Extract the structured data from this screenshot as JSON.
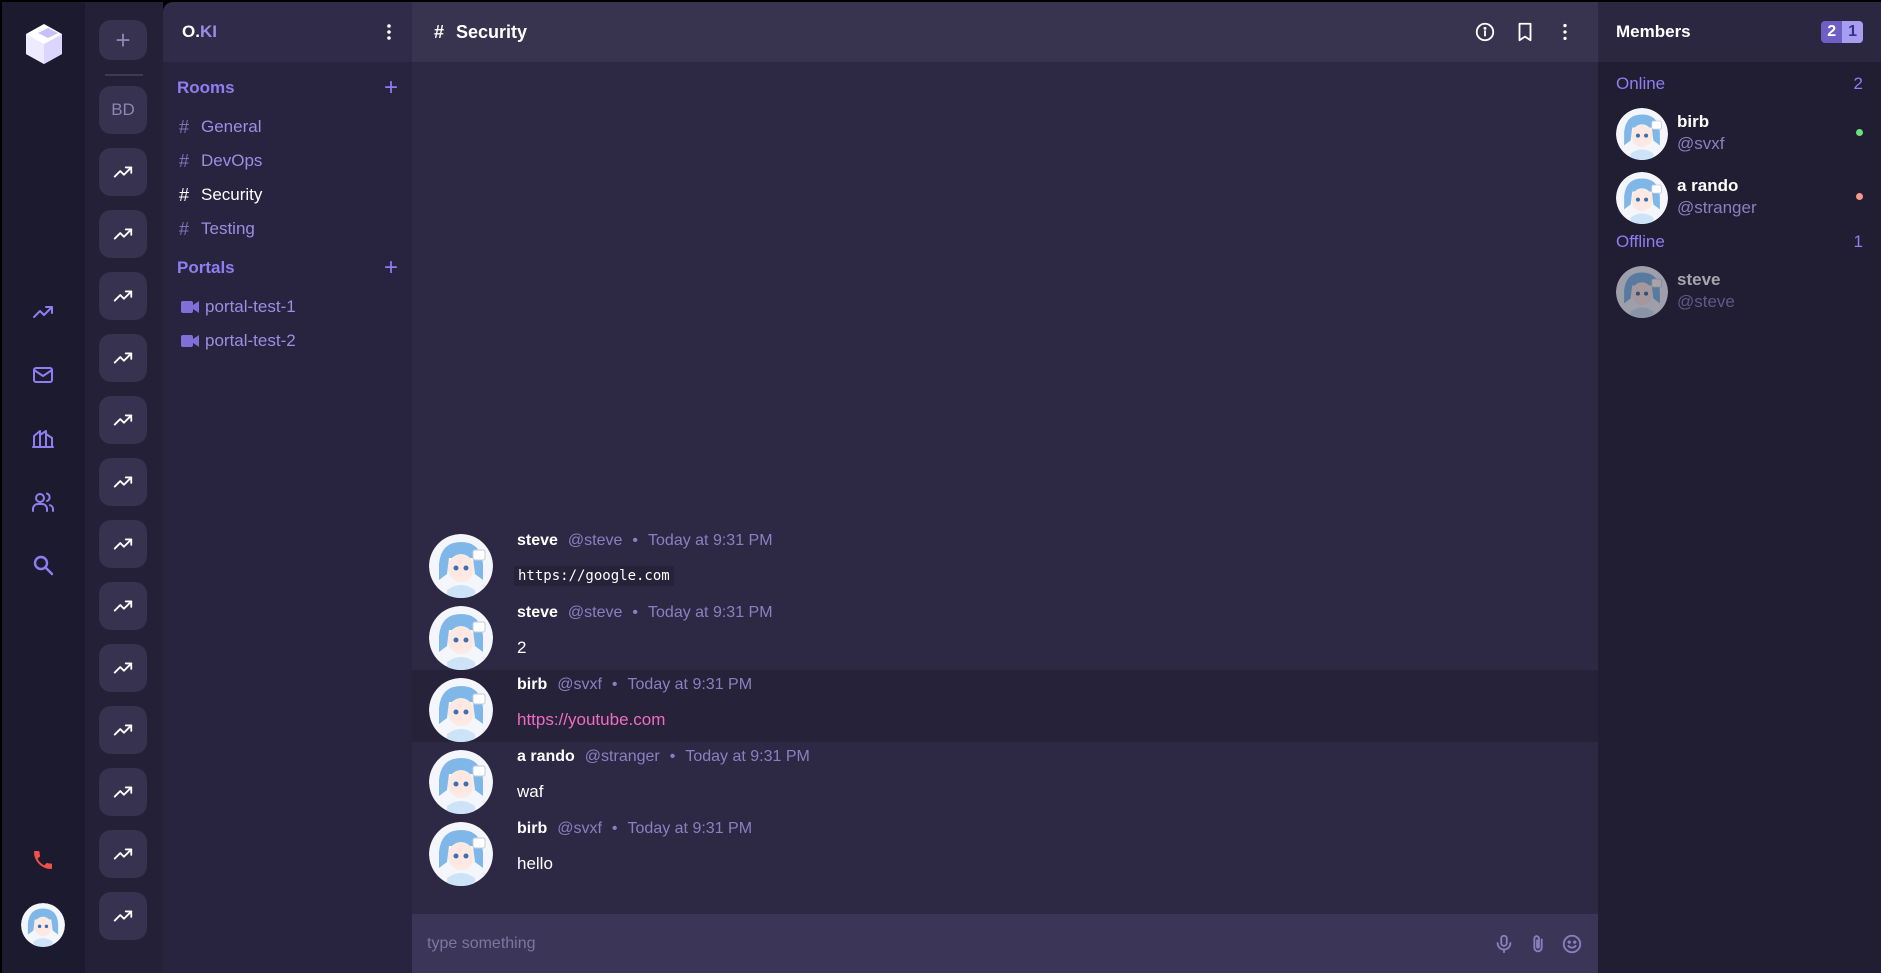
{
  "colors": {
    "online": "#69e27c",
    "away": "#f49a8c",
    "accent": "#8f7ef0",
    "link": "#ee6dc0",
    "call": "#f0524a"
  },
  "servers": {
    "add_label": "+",
    "initials": "BD",
    "trend_icon": "trending-up-icon",
    "trend_count": 13
  },
  "rail": {
    "icons": [
      "trending-up-icon",
      "mail-icon",
      "library-icon",
      "users-icon",
      "search-icon"
    ],
    "call_icon": "phone-icon"
  },
  "sidebar": {
    "title_main": "O.",
    "title_accent": "KI",
    "rooms_label": "Rooms",
    "rooms": [
      {
        "label": "General",
        "active": false
      },
      {
        "label": "DevOps",
        "active": false
      },
      {
        "label": "Security",
        "active": true
      },
      {
        "label": "Testing",
        "active": false
      }
    ],
    "portals_label": "Portals",
    "portals": [
      {
        "label": "portal-test-1"
      },
      {
        "label": "portal-test-2"
      }
    ],
    "hash": "#",
    "add": "+"
  },
  "header": {
    "hash": "#",
    "title": "Security",
    "icons": [
      "info-icon",
      "bookmark-icon",
      "more-vertical-icon"
    ]
  },
  "messages": [
    {
      "name": "steve",
      "handle": "@steve",
      "time": "Today at 9:31 PM",
      "body": "https://google.com",
      "kind": "code",
      "highlight": false
    },
    {
      "name": "steve",
      "handle": "@steve",
      "time": "Today at 9:31 PM",
      "body": "2",
      "kind": "text",
      "highlight": false
    },
    {
      "name": "birb",
      "handle": "@svxf",
      "time": "Today at 9:31 PM",
      "body": "https://youtube.com",
      "kind": "link",
      "highlight": true
    },
    {
      "name": "a rando",
      "handle": "@stranger",
      "time": "Today at 9:31 PM",
      "body": "waf",
      "kind": "text",
      "highlight": false
    },
    {
      "name": "birb",
      "handle": "@svxf",
      "time": "Today at 9:31 PM",
      "body": "hello",
      "kind": "text",
      "highlight": false
    }
  ],
  "composer": {
    "placeholder": "type something",
    "icons": [
      "microphone-icon",
      "paperclip-icon",
      "emoji-icon"
    ]
  },
  "members": {
    "title": "Members",
    "online_count": "2",
    "offline_count": "1",
    "online_label": "Online",
    "offline_label": "Offline",
    "online": [
      {
        "name": "birb",
        "handle": "@svxf",
        "status": "online"
      },
      {
        "name": "a rando",
        "handle": "@stranger",
        "status": "away"
      }
    ],
    "offline": [
      {
        "name": "steve",
        "handle": "@steve"
      }
    ]
  }
}
